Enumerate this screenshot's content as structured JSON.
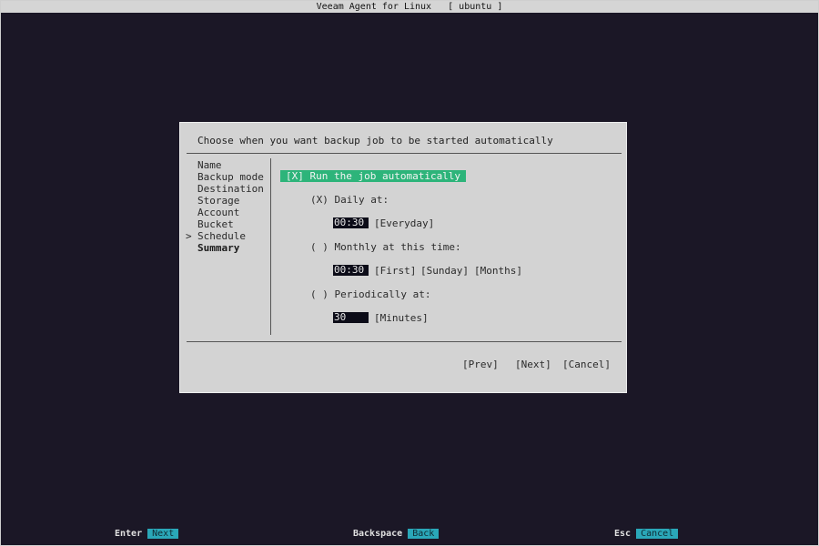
{
  "window": {
    "title": "Veeam Agent for Linux   [ ubuntu ]"
  },
  "dialog": {
    "prompt": "Choose when you want backup job to be started automatically",
    "steps": [
      {
        "label": "Name"
      },
      {
        "label": "Backup mode"
      },
      {
        "label": "Destination"
      },
      {
        "label": "Storage"
      },
      {
        "label": "Account"
      },
      {
        "label": "Bucket"
      },
      {
        "label": "Schedule",
        "current": true
      },
      {
        "label": "Summary",
        "bold": true
      }
    ],
    "current_marker": ">",
    "run_auto": "[X] Run the job automatically",
    "daily": {
      "label": "(X) Daily at:",
      "time": "00:30",
      "days": "[Everyday]"
    },
    "monthly": {
      "label": "( ) Monthly at this time:",
      "time": "00:30",
      "week": "[First]",
      "day": "[Sunday]",
      "months": "[Months]"
    },
    "periodic": {
      "label": "( ) Periodically at:",
      "value": "30",
      "unit": "[Minutes]"
    },
    "buttons": {
      "prev": "[Prev]",
      "next": "[Next]",
      "cancel": "[Cancel]"
    }
  },
  "footer": {
    "enter_key": "Enter",
    "enter_action": "Next",
    "backspace_key": "Backspace",
    "backspace_action": "Back",
    "esc_key": "Esc",
    "esc_action": "Cancel"
  },
  "colors": {
    "background": "#1b1726",
    "dialog": "#d3d3d3",
    "highlight": "#2db47a",
    "footer_action": "#2aa7b8"
  }
}
